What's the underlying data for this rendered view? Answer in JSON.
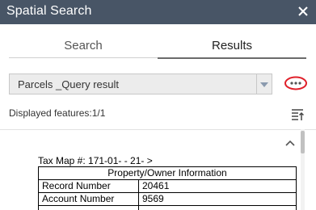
{
  "header": {
    "title": "Spatial Search"
  },
  "tabs": [
    {
      "label": "Search",
      "active": false
    },
    {
      "label": "Results",
      "active": true
    }
  ],
  "layer_select": {
    "value": "Parcels _Query result"
  },
  "results": {
    "count_text": "Displayed features:1/1",
    "tax_map": "Tax Map #: 171-01- - 21- >",
    "table": {
      "header": "Property/Owner Information",
      "rows": [
        {
          "label": "Record Number",
          "value": "20461"
        },
        {
          "label": "Account Number",
          "value": "9569"
        },
        {
          "label": "",
          "value": ""
        }
      ]
    }
  },
  "colors": {
    "titlebar": "#485566",
    "highlight_ring": "#e0202a"
  },
  "icons": {
    "close": "close-icon",
    "more": "more-options-icon",
    "sort": "sort-icon",
    "collapse": "chevron-up-icon",
    "dropdown": "dropdown-arrow-icon"
  }
}
